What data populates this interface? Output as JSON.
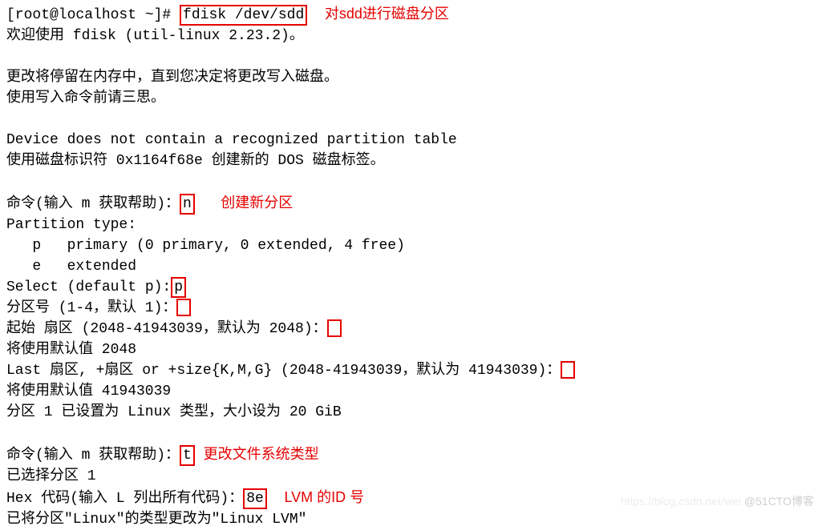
{
  "prompt": "[root@localhost ~]# ",
  "cmd": "fdisk /dev/sdd",
  "ann_cmd": "对sdd进行磁盘分区",
  "welcome": "欢迎使用 fdisk (util-linux 2.23.2)。",
  "msg1": "更改将停留在内存中，直到您决定将更改写入磁盘。",
  "msg2": "使用写入命令前请三思。",
  "err1": "Device does not contain a recognized partition table",
  "err2": "使用磁盘标识符 0x1164f68e 创建新的 DOS 磁盘标签。",
  "cmd_prompt": "命令(输入 m 获取帮助)：",
  "n": "n",
  "ann_n": "创建新分区",
  "pt_header": "Partition type:",
  "pt_p": "   p   primary (0 primary, 0 extended, 4 free)",
  "pt_e": "   e   extended",
  "select_prompt": "Select (default p):",
  "p": "p",
  "partno_prompt": "分区号 (1-4，默认 1)：",
  "first_prompt": "起始 扇区 (2048-41943039，默认为 2048)：",
  "use_first": "将使用默认值 2048",
  "last_prompt": "Last 扇区, +扇区 or +size{K,M,G} (2048-41943039，默认为 41943039)：",
  "use_last": "将使用默认值 41943039",
  "set_size": "分区 1 已设置为 Linux 类型，大小设为 20 GiB",
  "t": "t",
  "ann_t": "更改文件系统类型",
  "selected": "已选择分区 1",
  "hex_prompt": "Hex 代码(输入 L 列出所有代码)：",
  "hex": "8e",
  "ann_hex": "LVM 的ID 号",
  "changed": "已将分区\"Linux\"的类型更改为\"Linux LVM\"",
  "watermark1": "https://blog.csdn.net/wei",
  "watermark2": "@51CTO博客"
}
